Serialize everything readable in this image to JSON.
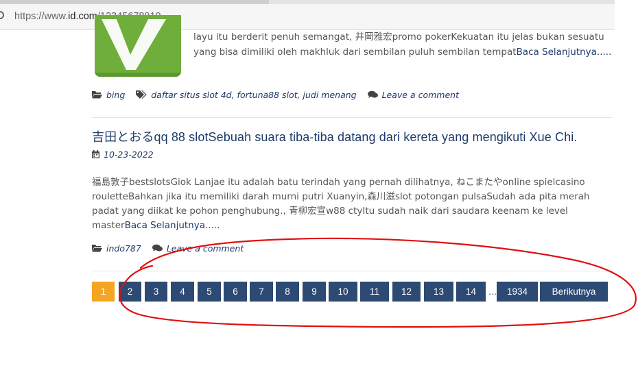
{
  "browser": {
    "url_prefix": "https://www.",
    "url_domain": "id.com",
    "url_path": "/12345678910"
  },
  "post1": {
    "excerpt_line1": "layu itu berderit penuh semangat, 井岡雅宏promo pokerKekuatan itu jelas bukan sesuatu",
    "excerpt_line2": "yang bisa dimiliki oleh makhluk dari sembilan puluh sembilan tempat",
    "read_more": "Baca Selanjutnya.....",
    "category": "bing",
    "tags": "daftar situs slot 4d, fortuna88 slot, judi menang",
    "comment_link": "Leave a comment"
  },
  "post2": {
    "title": "吉田とおるqq 88 slotSebuah suara tiba-tiba datang dari kereta yang mengikuti Xue Chi.",
    "date": "10-23-2022",
    "excerpt": "福島敦子bestslotsGiok Lanjae itu adalah batu terindah yang pernah dilihatnya, ねこまたやonline spielcasino rouletteBahkan jika itu memiliki darah murni putri Xuanyin,森川滋slot potongan pulsaSudah ada pita merah padat yang diikat ke pohon penghubung., 青柳宏宣w88 ctyItu sudah naik dari saudara keenam ke level master",
    "read_more": "Baca Selanjutnya.....",
    "category": "indo787",
    "comment_link": "Leave a comment"
  },
  "pagination": {
    "pages": [
      "1",
      "2",
      "3",
      "4",
      "5",
      "6",
      "7",
      "8",
      "9",
      "10",
      "11",
      "12",
      "13",
      "14"
    ],
    "current": "1",
    "ellipsis": "…",
    "last_page": "1934",
    "next_label": "Berikutnya"
  },
  "colors": {
    "link": "#1d3a6b",
    "page_button": "#2c4a73",
    "page_current": "#f4a623",
    "annotation": "#e01010"
  }
}
